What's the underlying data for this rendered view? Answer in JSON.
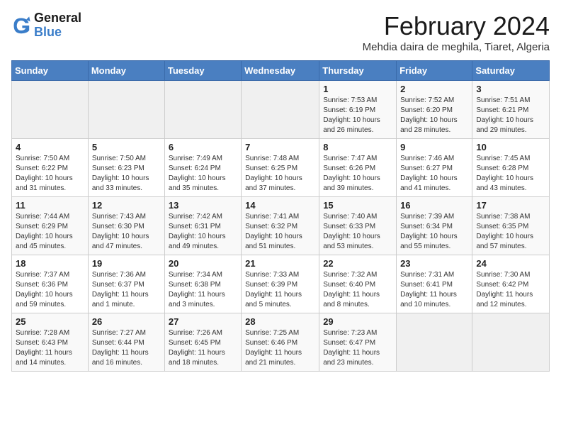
{
  "header": {
    "logo_general": "General",
    "logo_blue": "Blue",
    "title": "February 2024",
    "location": "Mehdia daira de meghila, Tiaret, Algeria"
  },
  "calendar": {
    "columns": [
      "Sunday",
      "Monday",
      "Tuesday",
      "Wednesday",
      "Thursday",
      "Friday",
      "Saturday"
    ],
    "accent_color": "#4a7fc1",
    "weeks": [
      [
        {
          "day": "",
          "info": ""
        },
        {
          "day": "",
          "info": ""
        },
        {
          "day": "",
          "info": ""
        },
        {
          "day": "",
          "info": ""
        },
        {
          "day": "1",
          "info": "Sunrise: 7:53 AM\nSunset: 6:19 PM\nDaylight: 10 hours and 26 minutes."
        },
        {
          "day": "2",
          "info": "Sunrise: 7:52 AM\nSunset: 6:20 PM\nDaylight: 10 hours and 28 minutes."
        },
        {
          "day": "3",
          "info": "Sunrise: 7:51 AM\nSunset: 6:21 PM\nDaylight: 10 hours and 29 minutes."
        }
      ],
      [
        {
          "day": "4",
          "info": "Sunrise: 7:50 AM\nSunset: 6:22 PM\nDaylight: 10 hours and 31 minutes."
        },
        {
          "day": "5",
          "info": "Sunrise: 7:50 AM\nSunset: 6:23 PM\nDaylight: 10 hours and 33 minutes."
        },
        {
          "day": "6",
          "info": "Sunrise: 7:49 AM\nSunset: 6:24 PM\nDaylight: 10 hours and 35 minutes."
        },
        {
          "day": "7",
          "info": "Sunrise: 7:48 AM\nSunset: 6:25 PM\nDaylight: 10 hours and 37 minutes."
        },
        {
          "day": "8",
          "info": "Sunrise: 7:47 AM\nSunset: 6:26 PM\nDaylight: 10 hours and 39 minutes."
        },
        {
          "day": "9",
          "info": "Sunrise: 7:46 AM\nSunset: 6:27 PM\nDaylight: 10 hours and 41 minutes."
        },
        {
          "day": "10",
          "info": "Sunrise: 7:45 AM\nSunset: 6:28 PM\nDaylight: 10 hours and 43 minutes."
        }
      ],
      [
        {
          "day": "11",
          "info": "Sunrise: 7:44 AM\nSunset: 6:29 PM\nDaylight: 10 hours and 45 minutes."
        },
        {
          "day": "12",
          "info": "Sunrise: 7:43 AM\nSunset: 6:30 PM\nDaylight: 10 hours and 47 minutes."
        },
        {
          "day": "13",
          "info": "Sunrise: 7:42 AM\nSunset: 6:31 PM\nDaylight: 10 hours and 49 minutes."
        },
        {
          "day": "14",
          "info": "Sunrise: 7:41 AM\nSunset: 6:32 PM\nDaylight: 10 hours and 51 minutes."
        },
        {
          "day": "15",
          "info": "Sunrise: 7:40 AM\nSunset: 6:33 PM\nDaylight: 10 hours and 53 minutes."
        },
        {
          "day": "16",
          "info": "Sunrise: 7:39 AM\nSunset: 6:34 PM\nDaylight: 10 hours and 55 minutes."
        },
        {
          "day": "17",
          "info": "Sunrise: 7:38 AM\nSunset: 6:35 PM\nDaylight: 10 hours and 57 minutes."
        }
      ],
      [
        {
          "day": "18",
          "info": "Sunrise: 7:37 AM\nSunset: 6:36 PM\nDaylight: 10 hours and 59 minutes."
        },
        {
          "day": "19",
          "info": "Sunrise: 7:36 AM\nSunset: 6:37 PM\nDaylight: 11 hours and 1 minute."
        },
        {
          "day": "20",
          "info": "Sunrise: 7:34 AM\nSunset: 6:38 PM\nDaylight: 11 hours and 3 minutes."
        },
        {
          "day": "21",
          "info": "Sunrise: 7:33 AM\nSunset: 6:39 PM\nDaylight: 11 hours and 5 minutes."
        },
        {
          "day": "22",
          "info": "Sunrise: 7:32 AM\nSunset: 6:40 PM\nDaylight: 11 hours and 8 minutes."
        },
        {
          "day": "23",
          "info": "Sunrise: 7:31 AM\nSunset: 6:41 PM\nDaylight: 11 hours and 10 minutes."
        },
        {
          "day": "24",
          "info": "Sunrise: 7:30 AM\nSunset: 6:42 PM\nDaylight: 11 hours and 12 minutes."
        }
      ],
      [
        {
          "day": "25",
          "info": "Sunrise: 7:28 AM\nSunset: 6:43 PM\nDaylight: 11 hours and 14 minutes."
        },
        {
          "day": "26",
          "info": "Sunrise: 7:27 AM\nSunset: 6:44 PM\nDaylight: 11 hours and 16 minutes."
        },
        {
          "day": "27",
          "info": "Sunrise: 7:26 AM\nSunset: 6:45 PM\nDaylight: 11 hours and 18 minutes."
        },
        {
          "day": "28",
          "info": "Sunrise: 7:25 AM\nSunset: 6:46 PM\nDaylight: 11 hours and 21 minutes."
        },
        {
          "day": "29",
          "info": "Sunrise: 7:23 AM\nSunset: 6:47 PM\nDaylight: 11 hours and 23 minutes."
        },
        {
          "day": "",
          "info": ""
        },
        {
          "day": "",
          "info": ""
        }
      ]
    ]
  }
}
